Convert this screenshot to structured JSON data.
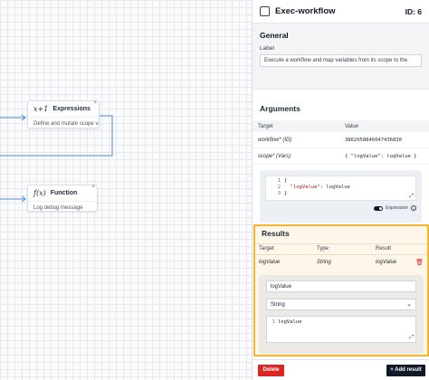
{
  "canvas": {
    "nodes": [
      {
        "icon": "x+1",
        "title": "Expressions",
        "desc": "Define and mutate scope v..."
      },
      {
        "icon": "f(x)",
        "title": "Function",
        "desc": "Log debug message"
      }
    ]
  },
  "panel": {
    "title": "Exec-workflow",
    "id_label": "ID: 6",
    "general_title": "General",
    "label_caption": "Label",
    "label_value": "Execute a workflow and map variables from its scope to the",
    "arguments_title": "Arguments",
    "args_table": {
      "headers": [
        "Target",
        "Value"
      ],
      "rows": [
        {
          "target": "workflow* (ID)",
          "value": "3862058846047436830"
        },
        {
          "target": "scope* (Vars)",
          "value": "{ \"logValue\": logValue }"
        }
      ]
    },
    "code_lines": [
      {
        "n": "1",
        "text": "{"
      },
      {
        "n": "2",
        "key": "\"logValue\"",
        "rest": ": logValue"
      },
      {
        "n": "3",
        "text": "}"
      }
    ],
    "expression_label": "Expression",
    "results_title": "Results",
    "results_table": {
      "headers": [
        "Target",
        "Type",
        "Result"
      ],
      "rows": [
        {
          "target": "logValue",
          "type": "String",
          "result": "logValue"
        }
      ]
    },
    "result_edit": {
      "target_value": "logValue",
      "type_value": "String",
      "code_line_num": "1",
      "code_text": "logValue"
    },
    "delete_label": "Delete",
    "add_result_label": "+ Add result"
  },
  "colors": {
    "accent": "#f2b632",
    "danger": "#dc2626",
    "dark": "#111827"
  }
}
